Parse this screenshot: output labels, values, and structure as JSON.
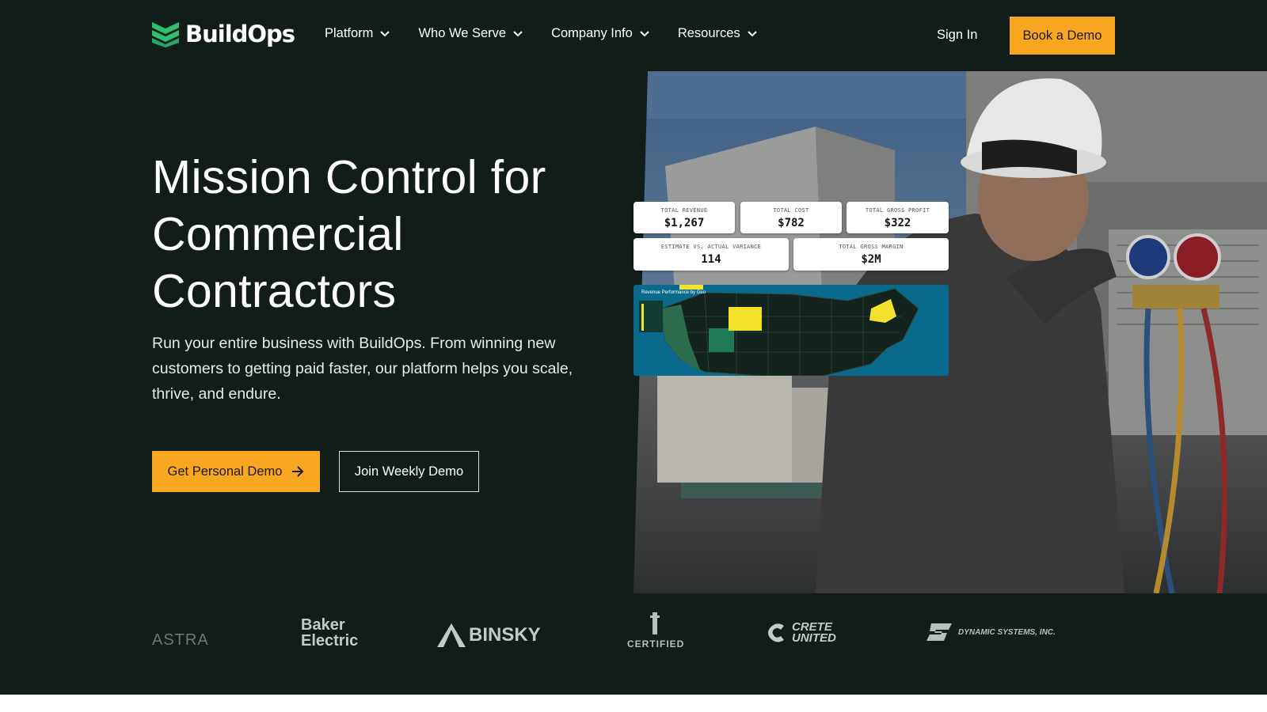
{
  "header": {
    "brand": "BuildOps",
    "nav": [
      {
        "label": "Platform"
      },
      {
        "label": "Who We Serve"
      },
      {
        "label": "Company Info"
      },
      {
        "label": "Resources"
      }
    ],
    "sign_in": "Sign In",
    "book_demo": "Book a Demo"
  },
  "hero": {
    "title_lines": [
      "Mission Control for",
      "Commercial",
      "Contractors"
    ],
    "subtitle": "Run your entire business with BuildOps. From winning new customers to getting paid faster, our platform helps you scale, thrive, and endure.",
    "primary_cta": "Get Personal Demo",
    "secondary_cta": "Join Weekly Demo"
  },
  "dashboard": {
    "stats": [
      {
        "label": "TOTAL REVENUE",
        "value": "$1,267"
      },
      {
        "label": "TOTAL COST",
        "value": "$782"
      },
      {
        "label": "TOTAL GROSS PROFIT",
        "value": "$322"
      },
      {
        "label": "ESTIMATE VS. ACTUAL VARIANCE",
        "value": "114"
      },
      {
        "label": "TOTAL GROSS MARGIN",
        "value": "$2M"
      }
    ],
    "map_title": "Revenue Performance by Geo"
  },
  "logos": [
    {
      "name": "ASTRA"
    },
    {
      "name": "Baker Electric"
    },
    {
      "name": "BINSKY"
    },
    {
      "name": "CERTIFIED"
    },
    {
      "name": "CRETE UNITED"
    },
    {
      "name": "DYNAMIC SYSTEMS, INC."
    }
  ],
  "colors": {
    "background": "#121d19",
    "accent": "#f9a620",
    "brand_green": "#2fbf71"
  }
}
